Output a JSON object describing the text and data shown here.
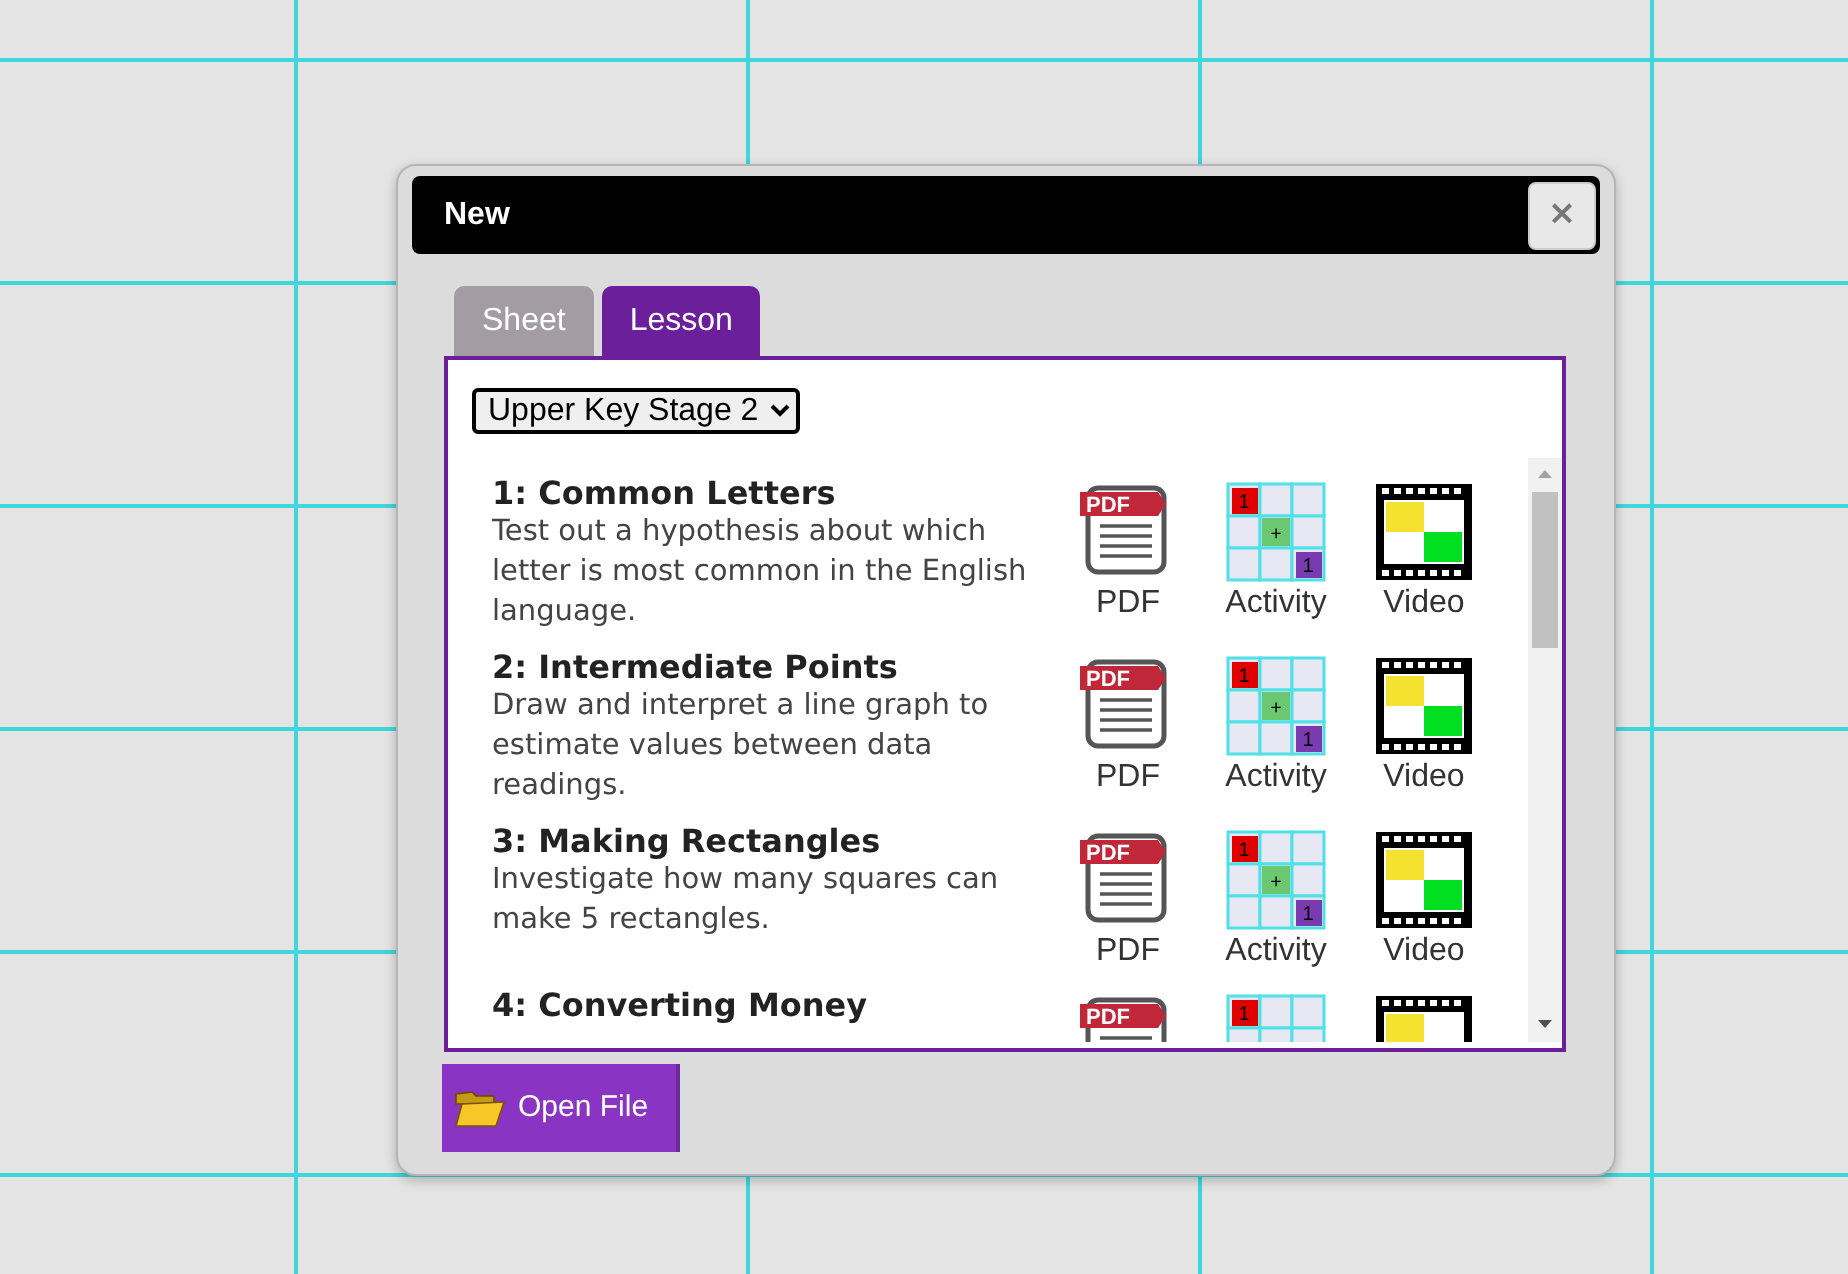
{
  "window": {
    "title": "New",
    "close": "×"
  },
  "tabs": [
    {
      "label": "Sheet",
      "selected": false
    },
    {
      "label": "Lesson",
      "selected": true
    }
  ],
  "stage_select": {
    "value": "Upper Key Stage 2"
  },
  "lessons": [
    {
      "title": "1: Common Letters",
      "description": "Test out a hypothesis about which letter is most common in the English language.",
      "resources": [
        {
          "kind": "pdf",
          "label": "PDF",
          "tag": "PDF"
        },
        {
          "kind": "activity",
          "label": "Activity",
          "marks": [
            "1",
            "+",
            "1"
          ]
        },
        {
          "kind": "video",
          "label": "Video"
        }
      ]
    },
    {
      "title": "2: Intermediate Points",
      "description": "Draw and interpret a line graph to estimate values between data readings.",
      "resources": [
        {
          "kind": "pdf",
          "label": "PDF",
          "tag": "PDF"
        },
        {
          "kind": "activity",
          "label": "Activity",
          "marks": [
            "1",
            "+",
            "1"
          ]
        },
        {
          "kind": "video",
          "label": "Video"
        }
      ]
    },
    {
      "title": "3: Making Rectangles",
      "description": "Investigate how many squares can make 5 rectangles.",
      "resources": [
        {
          "kind": "pdf",
          "label": "PDF",
          "tag": "PDF"
        },
        {
          "kind": "activity",
          "label": "Activity",
          "marks": [
            "1",
            "+",
            "1"
          ]
        },
        {
          "kind": "video",
          "label": "Video"
        }
      ]
    },
    {
      "title": "4: Converting Money",
      "resources": [
        {
          "kind": "pdf",
          "tag": "PDF"
        },
        {
          "kind": "activity",
          "marks": [
            "1"
          ]
        },
        {
          "kind": "video"
        }
      ]
    }
  ],
  "open_button": {
    "label": "Open File"
  }
}
